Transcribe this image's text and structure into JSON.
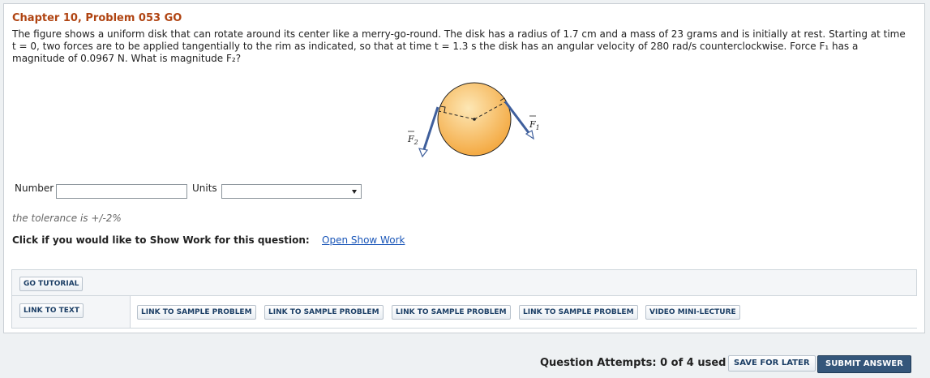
{
  "problem": {
    "title": "Chapter 10, Problem 053 GO",
    "line1": "The figure shows a uniform disk that can rotate around its center like a merry-go-round. The disk has a radius of 1.7 cm and a mass of 23 grams and is initially at rest. Starting at time",
    "line2": "t = 0, two forces are to be applied tangentially to the rim as indicated, so that at time t = 1.3 s the disk has an angular velocity of 280 rad/s counterclockwise. Force F₁ has a",
    "line3": "magnitude of 0.0967 N. What is magnitude F₂?"
  },
  "figure": {
    "f1_label": "F",
    "f1_sub": "1",
    "f2_label": "F",
    "f2_sub": "2",
    "colors": {
      "disk_light": "#fde0a0",
      "disk_dark": "#f3a53a",
      "arrow": "#3f5f9c"
    }
  },
  "answer": {
    "number_label": "Number",
    "number_value": "",
    "units_label": "Units",
    "units_selected": ""
  },
  "tolerance": "the tolerance is +/-2%",
  "show_work": {
    "prompt": "Click if you would like to Show Work for this question:",
    "link": "Open Show Work"
  },
  "resources": {
    "go_tutorial": "GO TUTORIAL",
    "link_to_text": "LINK TO TEXT",
    "sample1": "LINK TO SAMPLE PROBLEM",
    "sample2": "LINK TO SAMPLE PROBLEM",
    "sample3": "LINK TO SAMPLE PROBLEM",
    "sample4": "LINK TO SAMPLE PROBLEM",
    "video": "VIDEO MINI-LECTURE"
  },
  "footer": {
    "attempts": "Question Attempts: 0 of 4 used",
    "save": "SAVE FOR LATER",
    "submit": "SUBMIT ANSWER"
  }
}
